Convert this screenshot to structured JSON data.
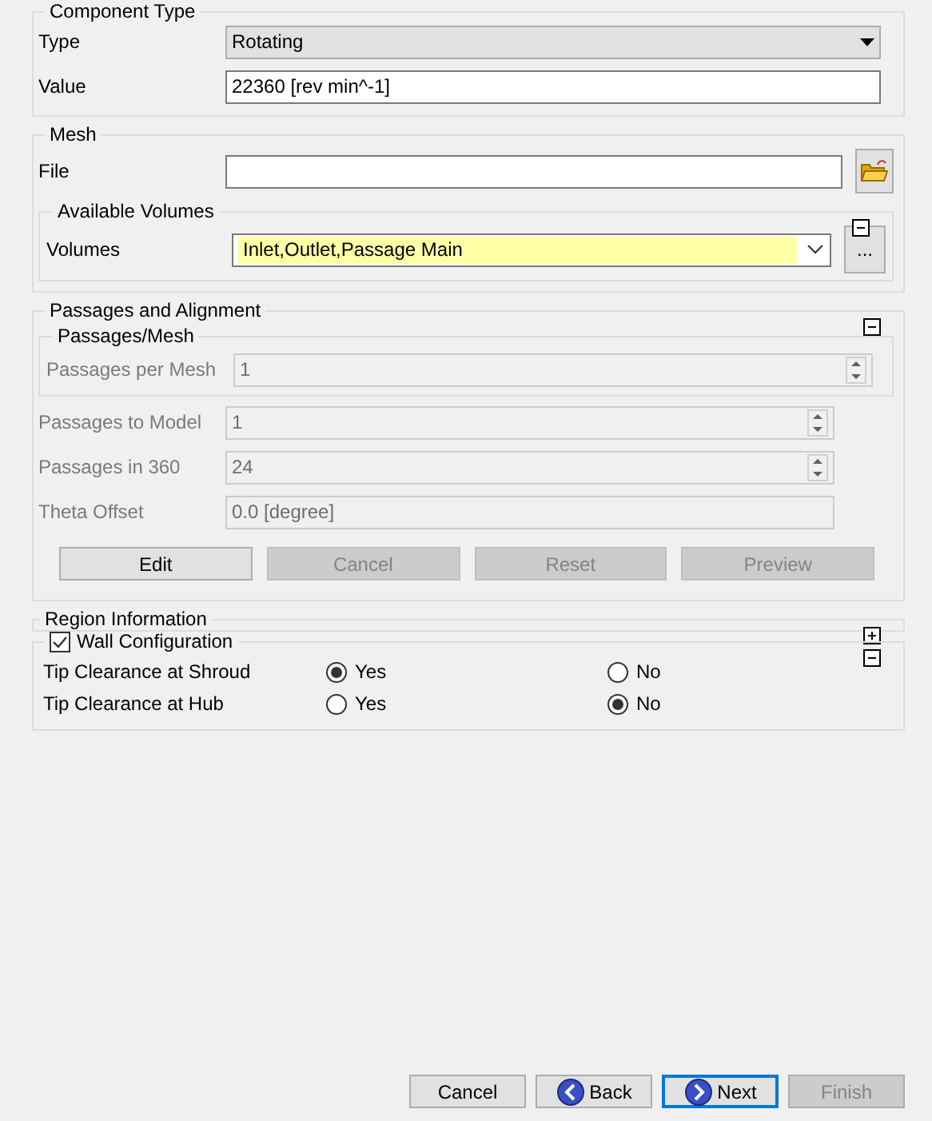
{
  "component_type": {
    "title": "Component Type",
    "fields": [
      {
        "kind": "dropdown",
        "label": "Type",
        "value": "Rotating"
      },
      {
        "kind": "text",
        "label": "Value",
        "value": "22360 [rev min^-1]"
      }
    ]
  },
  "mesh": {
    "title": "Mesh",
    "file_label": "File",
    "available_volumes": {
      "title": "Available Volumes",
      "expanded": true,
      "label": "Volumes",
      "value": "Inlet,Outlet,Passage Main",
      "browse": "..."
    }
  },
  "passages": {
    "title": "Passages and Alignment",
    "expanded": true,
    "sub": {
      "title": "Passages/Mesh",
      "fields": [
        {
          "kind": "spin",
          "label": "Passages per Mesh",
          "value": "1",
          "disabled": true
        }
      ]
    },
    "fields": [
      {
        "kind": "spin",
        "label": "Passages to Model",
        "value": "1",
        "disabled": true
      },
      {
        "kind": "spin",
        "label": "Passages in 360",
        "value": "24",
        "disabled": true
      },
      {
        "kind": "text",
        "label": "Theta Offset",
        "value": "0.0 [degree]",
        "disabled": true
      }
    ],
    "buttons": [
      {
        "label": "Edit",
        "disabled": false
      },
      {
        "label": "Cancel",
        "disabled": true
      },
      {
        "label": "Reset",
        "disabled": true
      },
      {
        "label": "Preview",
        "disabled": true
      }
    ]
  },
  "region_information": {
    "title": "Region Information",
    "expanded": false
  },
  "wall_configuration": {
    "title": "Wall Configuration",
    "checked": true,
    "expanded": true,
    "rows": [
      {
        "label": "Tip Clearance at Shroud",
        "options": [
          {
            "label": "Yes",
            "selected": true
          },
          {
            "label": "No",
            "selected": false
          }
        ]
      },
      {
        "label": "Tip Clearance at Hub",
        "options": [
          {
            "label": "Yes",
            "selected": false
          },
          {
            "label": "No",
            "selected": true
          }
        ]
      }
    ]
  },
  "footer_buttons": [
    {
      "kind": "plain",
      "label": "Cancel",
      "disabled": false,
      "focused": false
    },
    {
      "kind": "back",
      "label": "Back",
      "disabled": false,
      "focused": false
    },
    {
      "kind": "next",
      "label": "Next",
      "disabled": false,
      "focused": true
    },
    {
      "kind": "plain",
      "label": "Finish",
      "disabled": true,
      "focused": false
    }
  ]
}
